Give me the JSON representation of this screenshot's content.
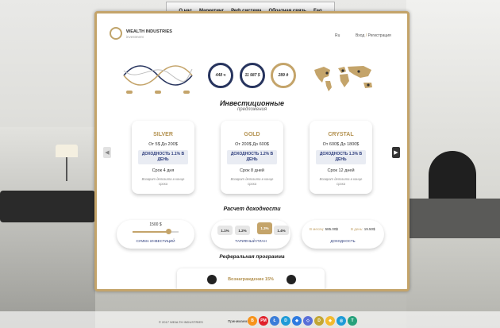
{
  "nav": {
    "items": [
      "О нас",
      "Маркетинг",
      "Реф система",
      "Обратная связь",
      "Faq"
    ]
  },
  "brand": {
    "name": "WEALTH INDUSTRIES",
    "sub": "investment"
  },
  "header": {
    "lang": "Ru",
    "login": "Вход",
    "sep": " / ",
    "register": "Регистрация"
  },
  "stats": [
    "448 ч",
    "11 987 $",
    "289 д"
  ],
  "invest": {
    "title": "Инвестиционные",
    "subtitle": "предложения"
  },
  "plans": [
    {
      "name": "SILVER",
      "range": "От 5$ До 200$",
      "yield": "ДОХОДНОСТЬ 1.1% В ДЕНЬ",
      "term": "Срок 4 дня",
      "note": "Возврат депозита в конце срока"
    },
    {
      "name": "GOLD",
      "range": "От 200$ До 600$",
      "yield": "ДОХОДНОСТЬ 1.2% В ДЕНЬ",
      "term": "Срок 8 дней",
      "note": "Возврат депозита в конце срока"
    },
    {
      "name": "CRYSTAL",
      "range": "От 600$ До 1800$",
      "yield": "ДОХОДНОСТЬ 1.3% В ДЕНЬ",
      "term": "Срок 12 дней",
      "note": "Возврат депозита в конце срока"
    }
  ],
  "calc": {
    "title": "Расчет доходности",
    "amount": "1500 $",
    "amount_fraction": 0.77,
    "amount_caption": "СУММА ИНВЕСТИЦИЙ",
    "rates": [
      "1.1%",
      "1.2%",
      "1.3%",
      "1.4%"
    ],
    "active_rate": "1.3%",
    "rate_caption": "ТАРИФНЫЙ ПЛАН",
    "month_label": "В месяц:",
    "month_value": "585.00$",
    "day_label": "В день:",
    "day_value": "19.50$",
    "income_caption": "ДОХОДНОСТЬ"
  },
  "referral": {
    "title": "Реферальная программа",
    "reward": "Вознаграждение 15%"
  },
  "footer": {
    "copyright": "© 2017 WEALTH INDUSTRIES",
    "accept": "Принимаем:",
    "payments": [
      {
        "glyph": "B",
        "color": "#f7931a"
      },
      {
        "glyph": "PM",
        "color": "#e0202a"
      },
      {
        "glyph": "Ł",
        "color": "#3b7dd8"
      },
      {
        "glyph": "D",
        "color": "#1e9bd7"
      },
      {
        "glyph": "◆",
        "color": "#2e7be0"
      },
      {
        "glyph": "◇",
        "color": "#5a6fd8"
      },
      {
        "glyph": "D",
        "color": "#c2a633"
      },
      {
        "glyph": "◈",
        "color": "#f3ba2f"
      },
      {
        "glyph": "◎",
        "color": "#1e9bd7"
      },
      {
        "glyph": "T",
        "color": "#26a17b"
      }
    ]
  }
}
